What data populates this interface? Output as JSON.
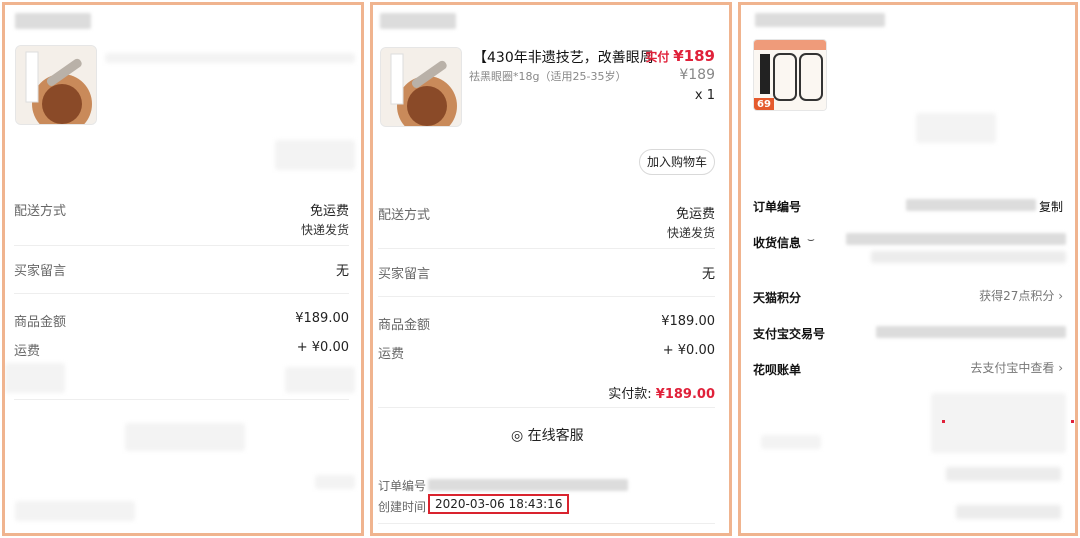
{
  "panel1": {
    "delivery_label": "配送方式",
    "delivery_value": "免运费",
    "delivery_sub": "快递发货",
    "note_label": "买家留言",
    "note_value": "无",
    "amount_label": "商品金额",
    "amount_value": "¥189.00",
    "shipping_label": "运费",
    "shipping_value": "+ ¥0.00"
  },
  "panel2": {
    "title": "【430年非遗技艺，改善眼周...",
    "paid_prefix": "实付",
    "paid_price": "¥189",
    "spec": "祛黑眼圈*18g（适用25-35岁）",
    "unit_price": "¥189",
    "quantity": "x 1",
    "add_cart": "加入购物车",
    "delivery_label": "配送方式",
    "delivery_value": "免运费",
    "delivery_sub": "快递发货",
    "note_label": "买家留言",
    "note_value": "无",
    "amount_label": "商品金额",
    "amount_value": "¥189.00",
    "shipping_label": "运费",
    "shipping_value": "+ ¥0.00",
    "total_label": "实付款:",
    "total_value": "¥189.00",
    "service_icon": "headset-icon",
    "service_label": "在线客服",
    "order_no_label": "订单编号",
    "created_label": "创建时间",
    "created_value": "2020-03-06 18:43:16"
  },
  "panel3": {
    "thumb_badge": "69",
    "order_no_label": "订单编号",
    "copy_label": "复制",
    "address_label": "收货信息",
    "points_label": "天猫积分",
    "points_value": "获得27点积分",
    "alipay_label": "支付宝交易号",
    "huabei_label": "花呗账单",
    "huabei_value": "去支付宝中查看"
  },
  "colors": {
    "panel_border": "#f0b48f",
    "price_red": "#e0213a",
    "highlight_red": "#d9232e"
  }
}
